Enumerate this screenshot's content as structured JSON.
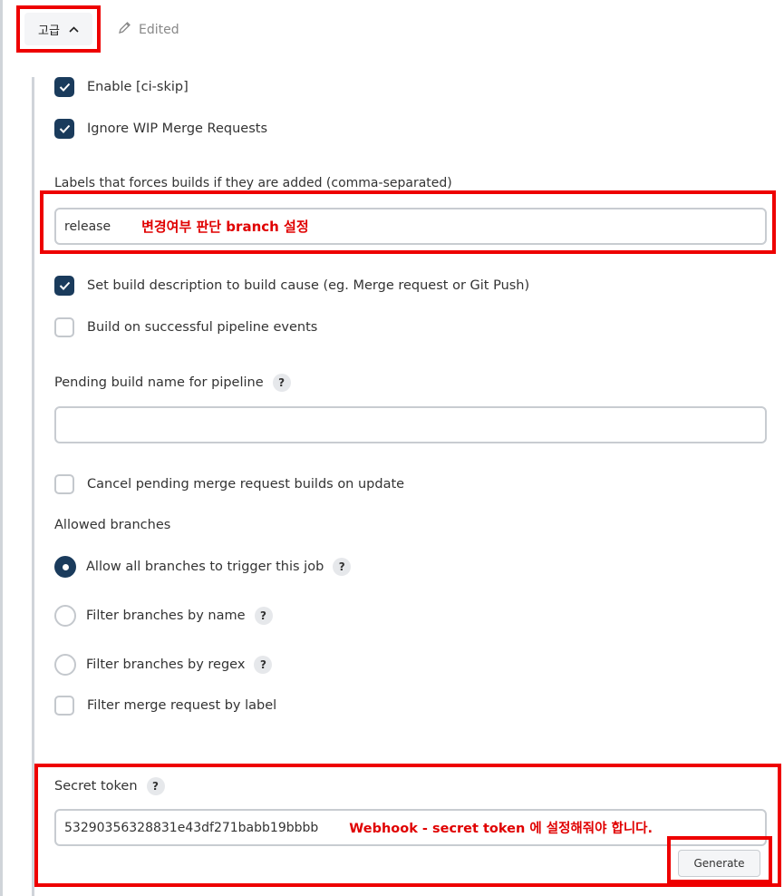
{
  "header": {
    "advanced_label": "고급",
    "edited_label": "Edited"
  },
  "options": {
    "enable_ci_skip": {
      "label": "Enable [ci-skip]",
      "checked": true
    },
    "ignore_wip": {
      "label": "Ignore WIP Merge Requests",
      "checked": true
    }
  },
  "labels_field": {
    "label": "Labels that forces builds if they are added (comma-separated)",
    "value": "release",
    "annotation": "변경여부 판단 branch 설정"
  },
  "options2": {
    "set_build_description": {
      "label": "Set build description to build cause (eg. Merge request or Git Push)",
      "checked": true
    },
    "build_on_pipeline": {
      "label": "Build on successful pipeline events",
      "checked": false
    }
  },
  "pending_build": {
    "label": "Pending build name for pipeline",
    "value": ""
  },
  "cancel_pending": {
    "label": "Cancel pending merge request builds on update",
    "checked": false
  },
  "allowed_branches": {
    "label": "Allowed branches",
    "options": [
      {
        "label": "Allow all branches to trigger this job",
        "selected": true
      },
      {
        "label": "Filter branches by name",
        "selected": false
      },
      {
        "label": "Filter branches by regex",
        "selected": false
      }
    ],
    "filter_by_label": {
      "label": "Filter merge request by label",
      "checked": false
    }
  },
  "secret_token": {
    "label": "Secret token",
    "value": "53290356328831e43df271babb19bbbb",
    "annotation": "Webhook - secret token 에 설정해줘야 합니다.",
    "generate_label": "Generate"
  },
  "help_glyph": "?",
  "colors": {
    "accent": "#1a3b5c",
    "annotation_red": "#ee0000"
  }
}
